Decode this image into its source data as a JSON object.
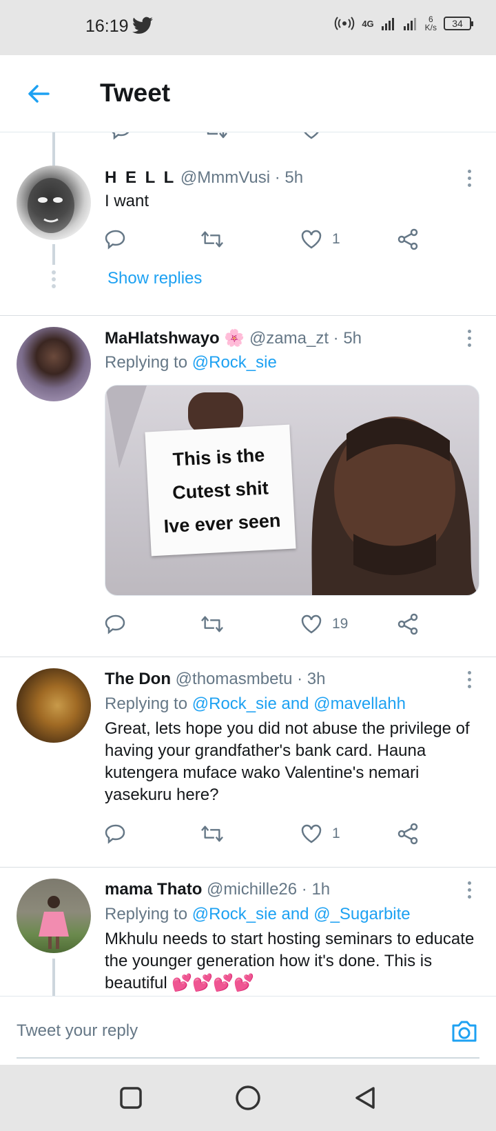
{
  "status_bar": {
    "time": "16:19",
    "network": "4G",
    "speed_value": "6",
    "speed_unit": "K/s",
    "battery": "34"
  },
  "header": {
    "title": "Tweet"
  },
  "tweets": [
    {
      "name": "H E L L",
      "handle": "@MmmVusi · 5h",
      "text": "I want",
      "likes": "1",
      "show_replies": "Show replies"
    },
    {
      "name": "MaHlatshwayo 🌸",
      "handle": "@zama_zt · 5h",
      "replying_prefix": "Replying to",
      "replying_to": "@Rock_sie",
      "media_lines": [
        "This is the",
        "Cutest shit",
        "Ive ever seen"
      ],
      "likes": "19"
    },
    {
      "name": "The Don",
      "handle": "@thomasmbetu · 3h",
      "replying_prefix": "Replying to",
      "replying_to": "@Rock_sie and @mavellahh",
      "text": "Great, lets hope you did not abuse the privilege of having your grandfather's bank card. Hauna kutengera muface wako Valentine's nemari yasekuru here?",
      "likes": "1"
    },
    {
      "name": "mama Thato",
      "handle": "@michille26 · 1h",
      "replying_prefix": "Replying to",
      "replying_to": "@Rock_sie and @_Sugarbite",
      "text": "Mkhulu needs to start hosting seminars to educate the younger generation how it's done. This is beautiful 💕💕💕💕"
    }
  ],
  "reply_bar": {
    "placeholder": "Tweet your reply"
  },
  "colors": {
    "accent": "#1da1f2",
    "secondary_text": "#657786",
    "system_bar": "#e6e6e6"
  },
  "icons": {
    "reply": "reply-icon",
    "retweet": "retweet-icon",
    "like": "heart-icon",
    "share": "share-icon",
    "camera": "camera-icon",
    "back": "back-arrow-icon"
  }
}
